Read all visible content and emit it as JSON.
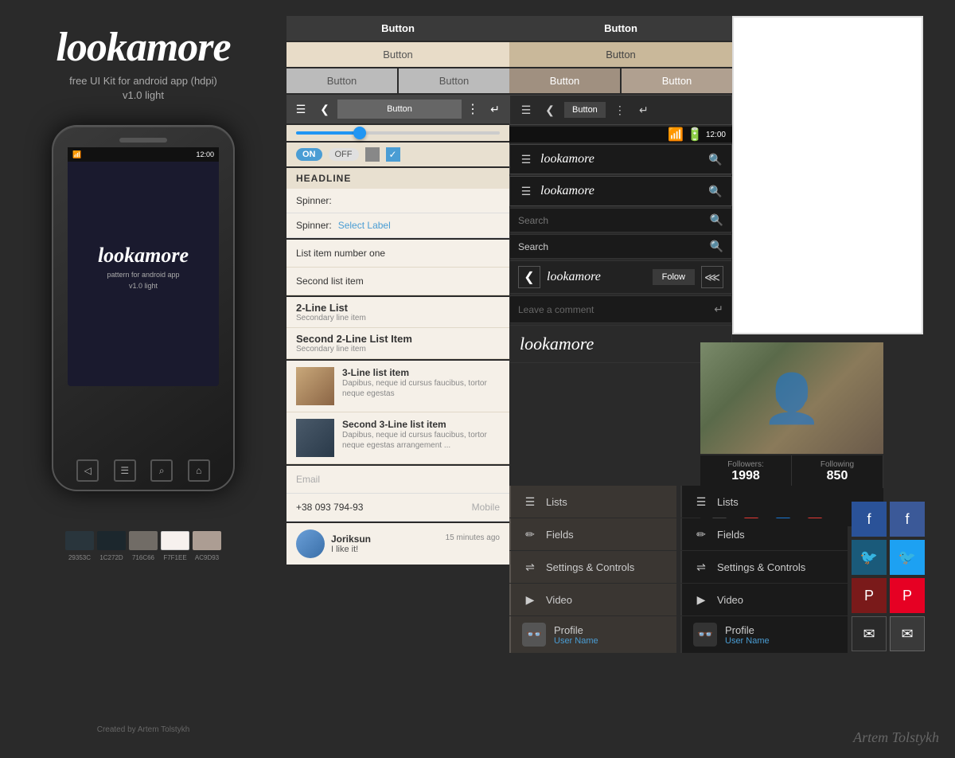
{
  "brand": {
    "logo": "lookamore",
    "tagline": "free UI Kit for android app (hdpi)",
    "version": "v1.0 light",
    "credit": "Created by Artem Tolstykh",
    "watermark": "Artem Tolstykh"
  },
  "colors": {
    "swatches": [
      {
        "hex": "#29353C",
        "label": "29353C"
      },
      {
        "hex": "#1C272D",
        "label": "1C272D"
      },
      {
        "hex": "#716C66",
        "label": "716C66"
      },
      {
        "hex": "#F7F1EE",
        "label": "F7F1EE"
      },
      {
        "hex": "#AC9D93",
        "label": "AC9D93"
      }
    ]
  },
  "buttons": {
    "dark_full": "Button",
    "light_full": "Button",
    "beige_left": "Button",
    "beige_right": "Button",
    "gray_left": "Button",
    "gray_right": "Button",
    "ab_center": "Button"
  },
  "dark_buttons": {
    "dark_full": "Button",
    "light_full": "Button",
    "beige_left": "Button",
    "beige_right": "Button",
    "ab_center": "Button"
  },
  "form": {
    "headline": "HEADLINE",
    "spinner1": "Spinner:",
    "spinner2": "Spinner:",
    "spinner2_label": "Select Label",
    "list1": "List item number one",
    "list2": "Second list item",
    "toggle_on": "ON",
    "toggle_off": "OFF"
  },
  "list2line": {
    "item1_primary": "2-Line List",
    "item1_secondary": "Secondary line item",
    "item2_primary": "Second 2-Line List Item",
    "item2_secondary": "Secondary line item"
  },
  "list3line": {
    "item1_primary": "3-Line list item",
    "item1_body": "Dapibus, neque id cursus faucibus, tortor neque egestas",
    "item2_primary": "Second 3-Line list item",
    "item2_body": "Dapibus, neque id cursus faucibus, tortor neque egestas arrangement ..."
  },
  "inputs": {
    "email_placeholder": "Email",
    "phone_value": "+38 093 794-93",
    "phone_hint": "Mobile"
  },
  "comment": {
    "author": "Joriksun",
    "time": "15 minutes ago",
    "text": "I like it!"
  },
  "dark_ui": {
    "logo": "lookamore",
    "logo2": "lookamore",
    "logo3": "lookamore",
    "search1_placeholder": "Search",
    "search2_placeholder": "Search",
    "follow_label": "Folow",
    "comment_placeholder": "Leave a comment"
  },
  "nav_menu": {
    "items": [
      {
        "icon": "≡",
        "label": "Lists",
        "active": false
      },
      {
        "icon": "✏",
        "label": "Fields",
        "active": false
      },
      {
        "icon": "⇌",
        "label": "Settings & Controls",
        "active": false
      },
      {
        "icon": "▶",
        "label": "Video",
        "active": false
      },
      {
        "icon": "👓",
        "label": "Profile",
        "active": false,
        "username": "User Name"
      }
    ]
  },
  "nav_menu_dark": {
    "items": [
      {
        "icon": "≡",
        "label": "Lists",
        "active": false
      },
      {
        "icon": "✏",
        "label": "Fields",
        "active": false
      },
      {
        "icon": "⇌",
        "label": "Settings & Controls",
        "active": false
      },
      {
        "icon": "▶",
        "label": "Video",
        "active": false
      },
      {
        "icon": "👓",
        "label": "Profile",
        "active": false,
        "username": "User Name"
      }
    ]
  },
  "profile": {
    "followers_label": "Followers:",
    "followers_count": "1998",
    "following_label": "Following",
    "following_count": "850"
  },
  "phone": {
    "logo": "lookamore",
    "sub1": "pattern for android app",
    "sub2": "v1.0 light",
    "time": "12:00"
  }
}
